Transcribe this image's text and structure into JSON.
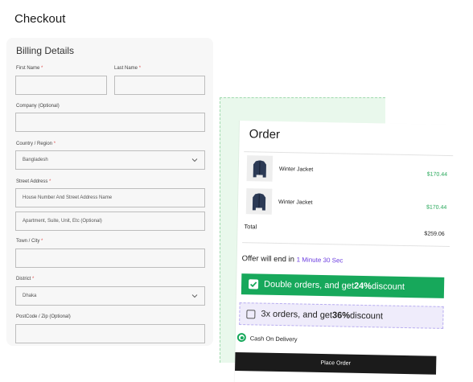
{
  "page": {
    "title": "Checkout"
  },
  "billing": {
    "title": "Billing Details",
    "first_name_label": "First Name",
    "last_name_label": "Last Name",
    "company_label": "Company (Optional)",
    "country_label": "Country / Region",
    "country_value": "Bangladesh",
    "street_label": "Street Address",
    "street_placeholder": "House Number And Street Address Name",
    "apartment_placeholder": "Apartment, Suite, Unit, Etc (Optional)",
    "town_label": "Town / City",
    "district_label": "District",
    "district_value": "Dhaka",
    "postcode_label": "PostCode / Zip (Optional)",
    "required_mark": "*"
  },
  "order": {
    "title": "Order",
    "items": [
      {
        "name": "Winter Jacket",
        "price": "$170.44"
      },
      {
        "name": "Winter Jacket",
        "price": "$170.44"
      }
    ],
    "total_label": "Total",
    "total_value": "$259.06",
    "offer_text": "Offer will end in",
    "offer_timer": "1 Minute 30 Sec",
    "deal1": {
      "prefix": "Double orders, and get ",
      "bold": "24%",
      "suffix": " discount",
      "checked": true
    },
    "deal2": {
      "prefix": "3x orders, and get ",
      "bold": "36%",
      "suffix": " discount",
      "checked": false
    },
    "payment_method": "Cash On Delivery",
    "place_order_label": "Place Order"
  },
  "colors": {
    "accent_green": "#17a85b",
    "accent_purple": "#6d3fe0",
    "dark": "#1b1b1b"
  },
  "icons": {
    "dropdown": "chevron-down-icon",
    "product": "jacket-icon",
    "check": "check-icon"
  }
}
